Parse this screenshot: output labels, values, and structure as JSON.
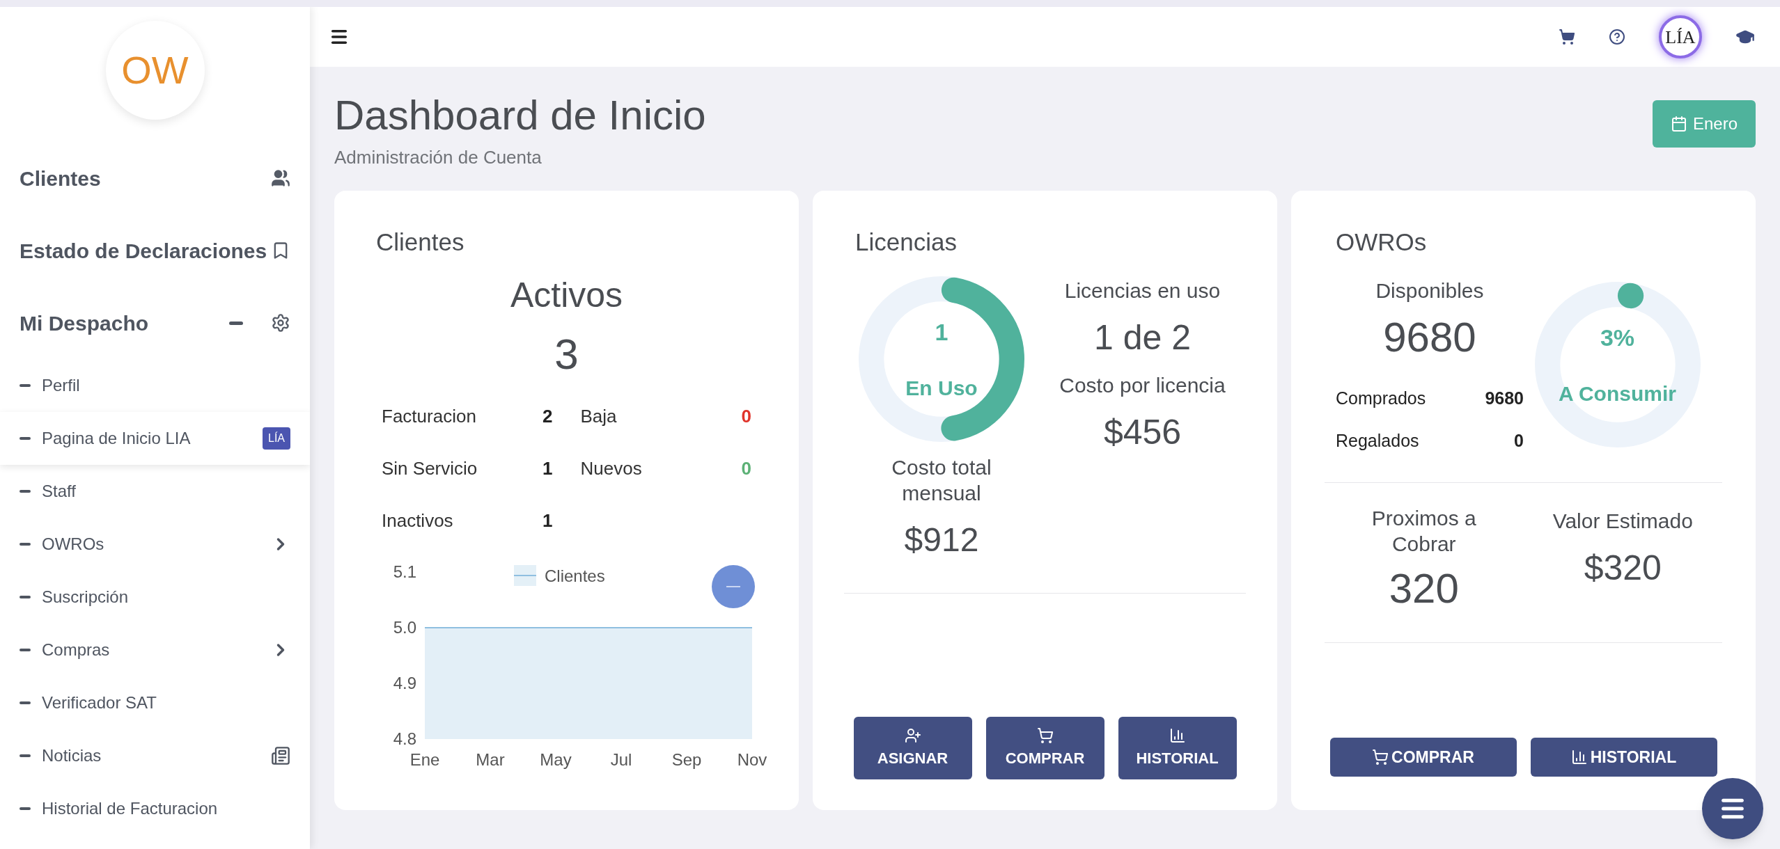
{
  "sidebar": {
    "logo": "OW",
    "sections": [
      {
        "label": "Clientes",
        "kind": "clients"
      },
      {
        "label": "Estado de Declaraciones",
        "kind": "declarations"
      },
      {
        "label": "Mi Despacho",
        "kind": "office",
        "expanded": true,
        "children": [
          {
            "label": "Perfil",
            "kind": "plain",
            "selected": false
          },
          {
            "label": "Pagina de Inicio LIA",
            "kind": "badge",
            "badge": "LÍA",
            "selected": true
          },
          {
            "label": "Staff",
            "kind": "plain",
            "selected": false
          },
          {
            "label": "OWROs",
            "kind": "submenu",
            "selected": false
          },
          {
            "label": "Suscripción",
            "kind": "plain",
            "selected": false
          },
          {
            "label": "Compras",
            "kind": "submenu",
            "selected": false
          },
          {
            "label": "Verificador SAT",
            "kind": "plain",
            "selected": false
          },
          {
            "label": "Noticias",
            "kind": "news",
            "selected": false
          },
          {
            "label": "Historial de Facturacion",
            "kind": "plain",
            "selected": false
          }
        ]
      }
    ]
  },
  "topbar": {
    "avatar": "LÍA"
  },
  "header": {
    "title": "Dashboard de Inicio",
    "subtitle": "Administración de Cuenta",
    "month_button": "Enero"
  },
  "clientes": {
    "title": "Clientes",
    "heading": "Activos",
    "count": "3",
    "stats": [
      {
        "label": "Facturacion",
        "value": "2",
        "color": "#222222"
      },
      {
        "label": "Baja",
        "value": "0",
        "color": "#e0342b"
      },
      {
        "label": "Sin Servicio",
        "value": "1",
        "color": "#222222"
      },
      {
        "label": "Nuevos",
        "value": "0",
        "color": "#5cb176"
      },
      {
        "label": "Inactivos",
        "value": "1",
        "color": "#222222"
      }
    ],
    "chart_data": {
      "type": "area",
      "categories": [
        "Ene",
        "Mar",
        "May",
        "Jul",
        "Sep",
        "Nov"
      ],
      "series": [
        {
          "name": "Clientes",
          "color": "#8fbfe0",
          "values": [
            5,
            5,
            5,
            5,
            5,
            5
          ]
        }
      ],
      "ylim": [
        4.8,
        5.1
      ],
      "yticks": [
        {
          "value": 4.8,
          "label": "4.8"
        },
        {
          "value": 4.9,
          "label": "4.9"
        },
        {
          "value": 5,
          "label": "5.0"
        },
        {
          "value": 5.1,
          "label": "5.1"
        }
      ]
    }
  },
  "licencias": {
    "title": "Licencias",
    "donut": {
      "level": 0.5,
      "value": "1",
      "label": "En Uso"
    },
    "in_use_label": "Licencias en uso",
    "in_use": "1 de 2",
    "cost_label": "Costo por licencia",
    "cost": "$456",
    "total_label": "Costo total mensual",
    "total": "$912",
    "buttons": [
      {
        "label": "ASIGNAR",
        "kind": "assign"
      },
      {
        "label": "COMPRAR",
        "kind": "buy"
      },
      {
        "label": "HISTORIAL",
        "kind": "history"
      }
    ]
  },
  "owros": {
    "title": "OWROs",
    "available_label": "Disponibles",
    "available": "9680",
    "stats": [
      {
        "label": "Comprados",
        "value": "9680"
      },
      {
        "label": "Regalados",
        "value": "0"
      }
    ],
    "donut": {
      "level": 0.03,
      "value": "3%",
      "label": "A Consumir"
    },
    "upcoming_label": "Proximos a Cobrar",
    "upcoming": "320",
    "estimate_label": "Valor Estimado",
    "estimate": "$320",
    "buttons": [
      {
        "label": "COMPRAR",
        "kind": "buy"
      },
      {
        "label": "HISTORIAL",
        "kind": "history"
      }
    ]
  }
}
